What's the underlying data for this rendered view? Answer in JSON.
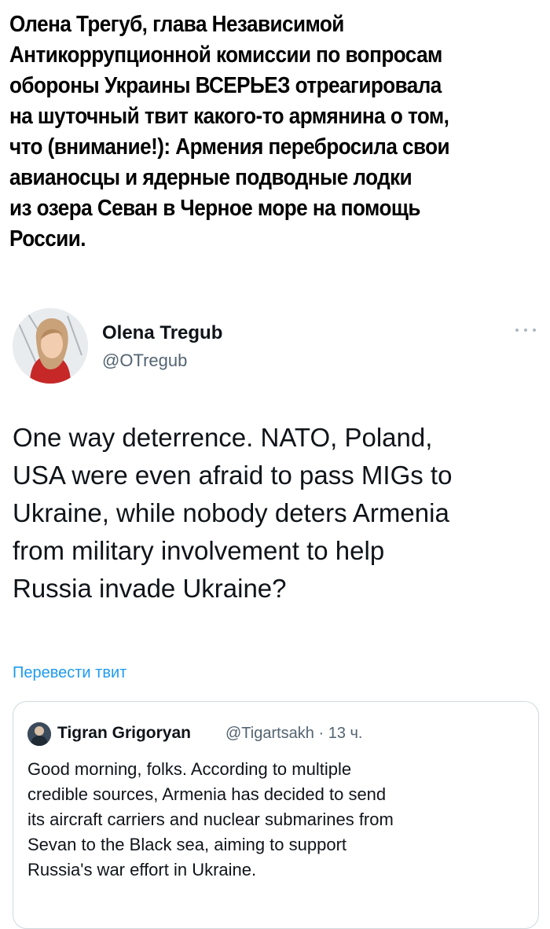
{
  "headline": {
    "lines": [
      "Олена Трегуб, глава Независимой",
      "Антикоррупционной комиссии по вопросам",
      "обороны Украины ВСЕРЬЕЗ отреагировала",
      "на шуточный твит какого-то армянина о том,",
      "что (внимание!): Армения перебросила свои",
      "авианосцы и ядерные подводные лодки",
      "из озера Севан в Черное море на помощь",
      "России."
    ]
  },
  "tweet": {
    "author_name": "Olena Tregub",
    "author_handle": "@OTregub",
    "avatar_icon": "user-avatar-photo",
    "more_icon": "more-options-icon",
    "body_lines": [
      "One way deterrence. NATO, Poland,",
      "USA were even afraid to pass MIGs to",
      "Ukraine, while nobody deters Armenia",
      "from military involvement to help",
      "Russia invade Ukraine?"
    ],
    "translate_label": "Перевести твит"
  },
  "quote": {
    "author_name": "Tigran Grigoryan",
    "meta": "@Tigartsakh · 13 ч.",
    "body_lines": [
      "Good morning, folks. According to multiple",
      "credible sources, Armenia has decided to send",
      "its aircraft carriers and nuclear submarines from",
      "Sevan to the Black sea, aiming to support",
      "Russia's war effort in Ukraine."
    ]
  },
  "colors": {
    "link": "#1d9bf0",
    "secondary_text": "#536471",
    "border": "#cfd9de"
  }
}
